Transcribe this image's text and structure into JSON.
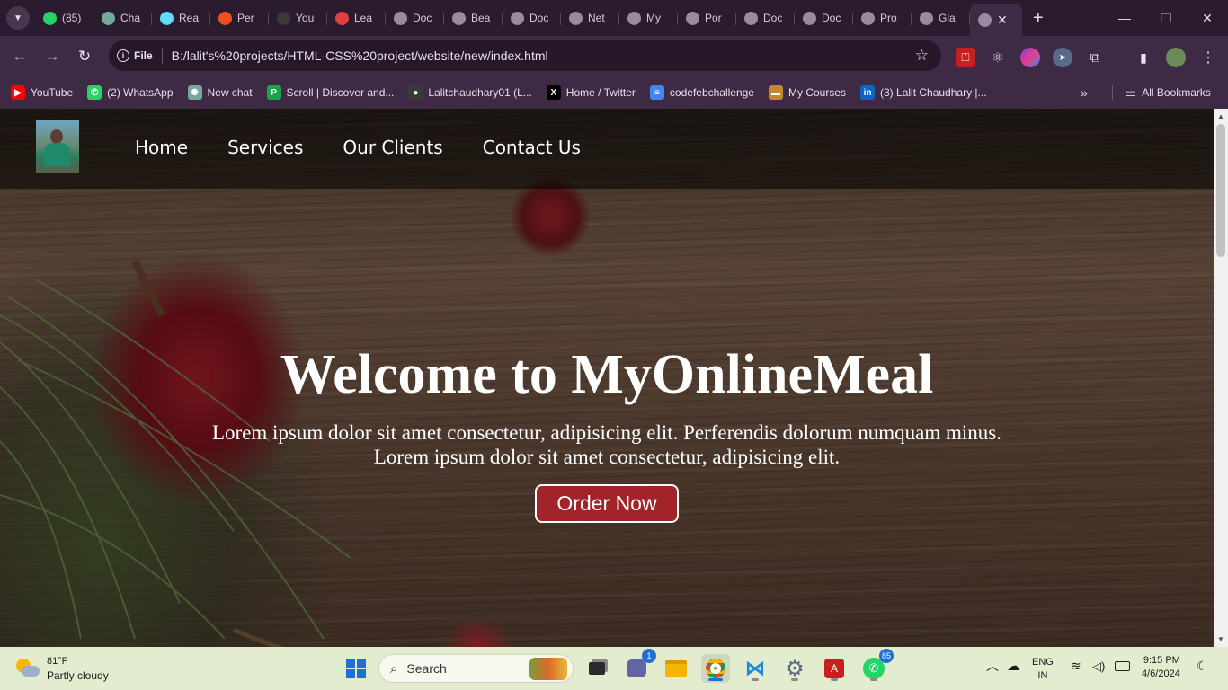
{
  "browser": {
    "tabs": [
      {
        "label": "(85)",
        "icon": "whatsapp-icon",
        "color": "#25d366"
      },
      {
        "label": "Cha",
        "icon": "chatgpt-icon",
        "color": "#74aa9c"
      },
      {
        "label": "Rea",
        "icon": "react-icon",
        "color": "#61dafb"
      },
      {
        "label": "Per",
        "icon": "figma-icon",
        "color": "#f24e1e"
      },
      {
        "label": "You",
        "icon": "github-icon",
        "color": "#3a3a3a"
      },
      {
        "label": "Lea",
        "icon": "codeforces-icon",
        "color": "#e24040"
      },
      {
        "label": "Doc",
        "icon": "globe-icon",
        "color": "#9a8aa0"
      },
      {
        "label": "Bea",
        "icon": "globe-icon",
        "color": "#9a8aa0"
      },
      {
        "label": "Doc",
        "icon": "globe-icon",
        "color": "#9a8aa0"
      },
      {
        "label": "Net",
        "icon": "globe-icon",
        "color": "#9a8aa0"
      },
      {
        "label": "My",
        "icon": "globe-icon",
        "color": "#9a8aa0"
      },
      {
        "label": "Por",
        "icon": "globe-icon",
        "color": "#9a8aa0"
      },
      {
        "label": "Doc",
        "icon": "globe-icon",
        "color": "#9a8aa0"
      },
      {
        "label": "Doc",
        "icon": "globe-icon",
        "color": "#9a8aa0"
      },
      {
        "label": "Pro",
        "icon": "globe-icon",
        "color": "#9a8aa0"
      },
      {
        "label": "Gla",
        "icon": "globe-icon",
        "color": "#9a8aa0"
      }
    ],
    "active_tab_label": "",
    "address": {
      "chip": "File",
      "url": "B:/lalit's%20projects/HTML-CSS%20project/website/new/index.html"
    },
    "bookmarks": [
      {
        "label": "YouTube",
        "icon": "youtube-icon",
        "color": "#ff0000",
        "glyph": "▶"
      },
      {
        "label": "(2) WhatsApp",
        "icon": "whatsapp-icon",
        "color": "#25d366",
        "glyph": "✆"
      },
      {
        "label": "New chat",
        "icon": "chatgpt-icon",
        "color": "#74aa9c",
        "glyph": "✺"
      },
      {
        "label": "Scroll | Discover and...",
        "icon": "scroll-icon",
        "color": "#1aa34a",
        "glyph": "P"
      },
      {
        "label": "Lalitchaudhary01 (L...",
        "icon": "github-icon",
        "color": "#3a3a3a",
        "glyph": "●"
      },
      {
        "label": "Home / Twitter",
        "icon": "x-icon",
        "color": "#000000",
        "glyph": "X"
      },
      {
        "label": "codefebchallenge",
        "icon": "doc-icon",
        "color": "#4285f4",
        "glyph": "≡"
      },
      {
        "label": "My Courses",
        "icon": "courses-icon",
        "color": "#c08a2a",
        "glyph": "▬"
      },
      {
        "label": "(3) Lalit Chaudhary |...",
        "icon": "linkedin-icon",
        "color": "#0a66c2",
        "glyph": "in"
      }
    ],
    "bookmarks_more": "»",
    "all_bookmarks": "All Bookmarks"
  },
  "site": {
    "nav": [
      "Home",
      "Services",
      "Our Clients",
      "Contact Us"
    ],
    "hero_title": "Welcome to MyOnlineMeal",
    "hero_line1": "Lorem ipsum dolor sit amet consectetur, adipisicing elit. Perferendis dolorum numquam minus.",
    "hero_line2": "Lorem ipsum dolor sit amet consectetur, adipisicing elit.",
    "cta": "Order Now",
    "accent": "#a2232a"
  },
  "taskbar": {
    "weather_temp": "81°F",
    "weather_desc": "Partly cloudy",
    "search_placeholder": "Search",
    "teams_badge": "1",
    "whatsapp_badge": "85",
    "lang_line1": "ENG",
    "lang_line2": "IN",
    "time": "9:15 PM",
    "date": "4/6/2024"
  }
}
